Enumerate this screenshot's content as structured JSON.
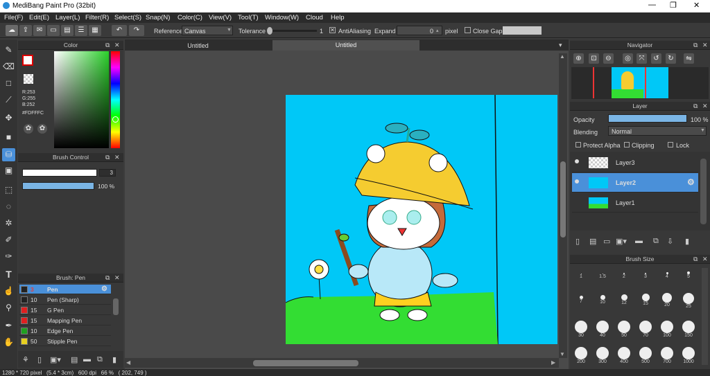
{
  "window": {
    "title": "MediBang Paint Pro (32bit)"
  },
  "menu": [
    "File(F)",
    "Edit(E)",
    "Layer(L)",
    "Filter(R)",
    "Select(S)",
    "Snap(N)",
    "Color(C)",
    "View(V)",
    "Tool(T)",
    "Window(W)",
    "Cloud",
    "Help"
  ],
  "toolbar": {
    "reference_label": "Reference",
    "reference_value": "Canvas",
    "tolerance_label": "Tolerance",
    "tolerance_value": "1",
    "antialiasing_label": "AntiAliasing",
    "expand_label": "Expand",
    "expand_value": "0",
    "expand_unit": "pixel",
    "close_gaps_label": "Close Gaps"
  },
  "tabs": [
    "Untitled",
    "Untitled"
  ],
  "color": {
    "title": "Color",
    "r": "R:253",
    "g": "G:255",
    "b": "B:252",
    "hex": "#FDFFFC"
  },
  "brush_control": {
    "title": "Brush Control",
    "size": "3",
    "opacity": "100 %"
  },
  "brush": {
    "title": "Brush: Pen",
    "items": [
      {
        "size": "3",
        "name": "Pen",
        "color": "#222222"
      },
      {
        "size": "10",
        "name": "Pen (Sharp)",
        "color": "#222222"
      },
      {
        "size": "15",
        "name": "G Pen",
        "color": "#e02020"
      },
      {
        "size": "15",
        "name": "Mapping Pen",
        "color": "#e02020"
      },
      {
        "size": "10",
        "name": "Edge Pen",
        "color": "#20a020"
      },
      {
        "size": "50",
        "name": "Stipple Pen",
        "color": "#e8d020"
      }
    ]
  },
  "navigator": {
    "title": "Navigator"
  },
  "layer": {
    "title": "Layer",
    "opacity_label": "Opacity",
    "opacity_value": "100 %",
    "blending_label": "Blending",
    "blending_value": "Normal",
    "protect_alpha": "Protect Alpha",
    "clipping": "Clipping",
    "lock": "Lock",
    "layers": [
      "Layer3",
      "Layer2",
      "Layer1"
    ]
  },
  "brush_size": {
    "title": "Brush Size",
    "sizes": [
      "1",
      "1.5",
      "2",
      "3",
      "4",
      "5",
      "7",
      "10",
      "12",
      "15",
      "20",
      "25",
      "30",
      "40",
      "50",
      "70",
      "100",
      "150",
      "200",
      "300",
      "400",
      "500",
      "700",
      "1000"
    ]
  },
  "status": {
    "text": "1280 * 720 pixel   (5.4 * 3cm)   600 dpi   66 %   ( 202, 749 )"
  }
}
